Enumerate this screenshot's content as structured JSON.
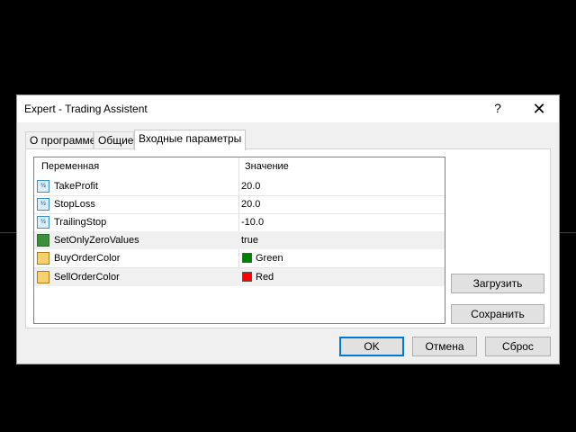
{
  "window": {
    "title": "Expert - Trading Assistent",
    "help_glyph": "?",
    "close_glyph": "✕"
  },
  "tabs": [
    {
      "label": "О программе"
    },
    {
      "label": "Общие"
    },
    {
      "label": "Входные параметры"
    }
  ],
  "table": {
    "headers": {
      "variable": "Переменная",
      "value": "Значение"
    },
    "rows": [
      {
        "name": "TakeProfit",
        "value": "20.0",
        "icon": "numeric-icon"
      },
      {
        "name": "StopLoss",
        "value": "20.0",
        "icon": "numeric-icon"
      },
      {
        "name": "TrailingStop",
        "value": "-10.0",
        "icon": "numeric-icon"
      },
      {
        "name": "SetOnlyZeroValues",
        "value": "true",
        "icon": "boolean-icon"
      },
      {
        "name": "BuyOrderColor",
        "value": "Green",
        "icon": "color-icon",
        "swatch": "#008000"
      },
      {
        "name": "SellOrderColor",
        "value": "Red",
        "icon": "color-icon",
        "swatch": "#ff0000"
      }
    ]
  },
  "side_buttons": {
    "load": "Загрузить",
    "save": "Сохранить"
  },
  "footer": {
    "ok": "OK",
    "cancel": "Отмена",
    "reset": "Сброс"
  },
  "numeric_icon_text": "½"
}
